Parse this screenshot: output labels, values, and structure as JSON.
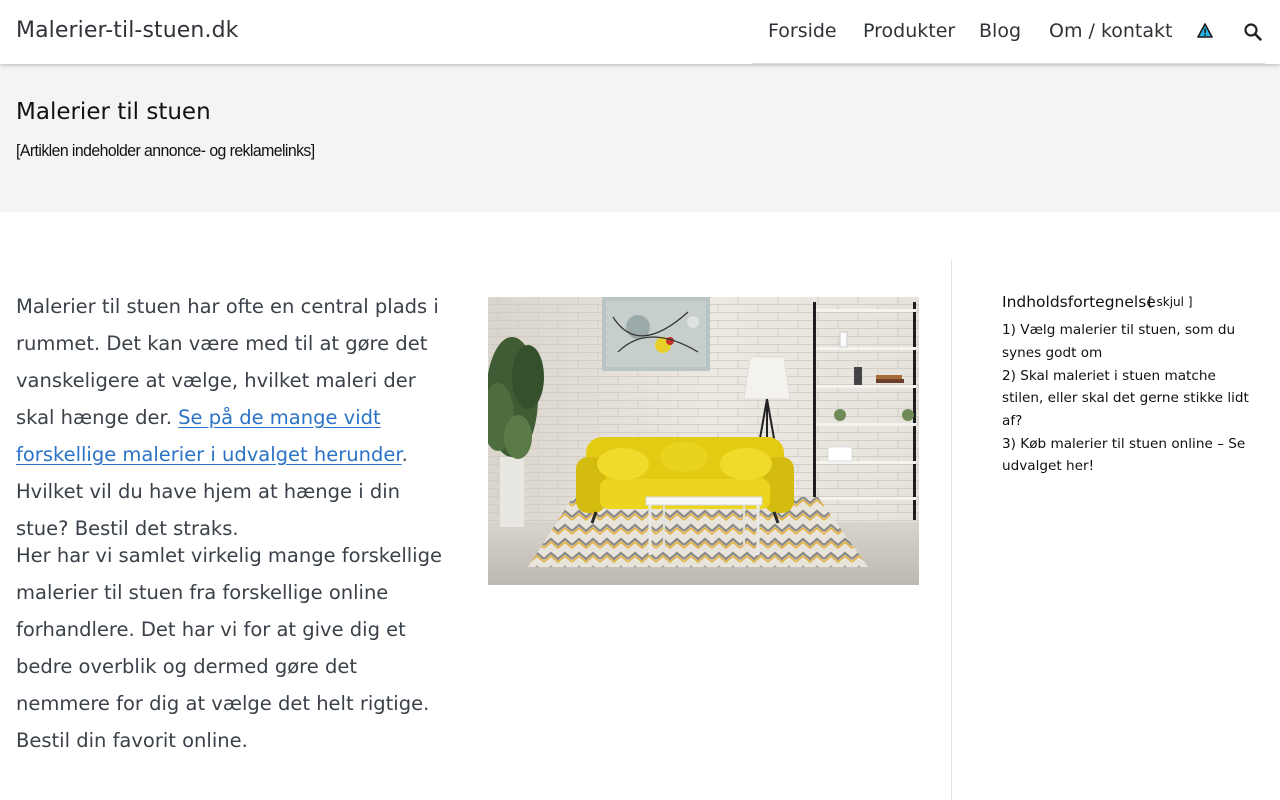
{
  "site": {
    "title": "Malerier-til-stuen.dk"
  },
  "nav": {
    "items": [
      {
        "label": "Forside"
      },
      {
        "label": "Produkter"
      },
      {
        "label": "Blog"
      },
      {
        "label": "Om / kontakt"
      }
    ],
    "icons": {
      "warning": "warning-triangle-icon",
      "search": "search-icon"
    }
  },
  "hero": {
    "title": "Malerier til stuen",
    "disclaimer": "[Artiklen indeholder annonce- og reklamelinks]"
  },
  "article": {
    "p1_before": "Malerier til stuen har ofte en central plads i rummet. Det kan være med til at gøre det vanskeligere at vælge, hvilket maleri der skal hænge der. ",
    "p1_link": "Se på de mange vidt forskellige malerier i udvalget herunder",
    "p1_after": ". Hvilket vil du have hjem at hænge i din stue? Bestil det straks.",
    "p2": "Her har vi samlet virkelig mange forskellige malerier til stuen fra forskellige online forhandlere. Det har vi for at give dig et bedre overblik og dermed gøre det nemmere for dig at vælge det helt rigtige. Bestil din favorit online."
  },
  "toc": {
    "title": "Indholdsfortegnelse",
    "toggle_open": "[",
    "toggle_label": "skjul",
    "toggle_close": "]",
    "items": [
      {
        "label": "1) Vælg malerier til stuen, som du synes godt om"
      },
      {
        "label": "2) Skal maleriet i stuen matche stilen, eller skal det gerne stikke lidt af?"
      },
      {
        "label": "3) Køb malerier til stuen online – Se udvalget her!"
      }
    ]
  },
  "colors": {
    "link": "#2a73c6",
    "sofa": "#e8d21e",
    "hero_bg": "#f4f4f4"
  }
}
